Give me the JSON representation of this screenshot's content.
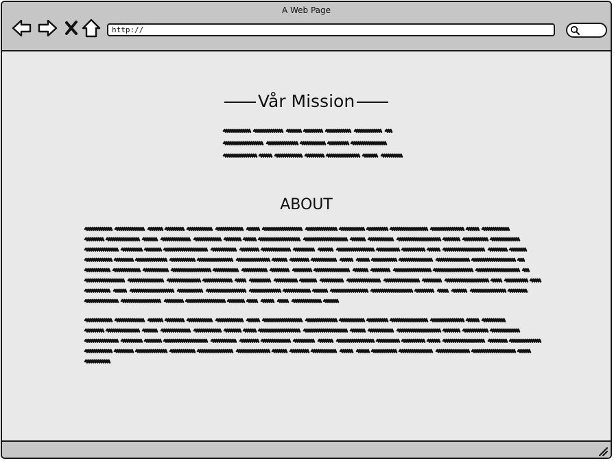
{
  "window": {
    "title": "A Web Page"
  },
  "toolbar": {
    "back_icon": "arrow-left-icon",
    "forward_icon": "arrow-right-icon",
    "stop_icon": "close-icon",
    "home_icon": "home-icon",
    "address_value": "http://",
    "search_icon": "search-icon"
  },
  "main": {
    "mission_heading": "Vår Mission",
    "about_heading": "ABOUT"
  },
  "statusbar": {
    "grip_icon": "resize-grip-icon"
  },
  "colors": {
    "chrome": "#c6c6c6",
    "page": "#e9e9e9",
    "ink": "#1a1a1a"
  }
}
